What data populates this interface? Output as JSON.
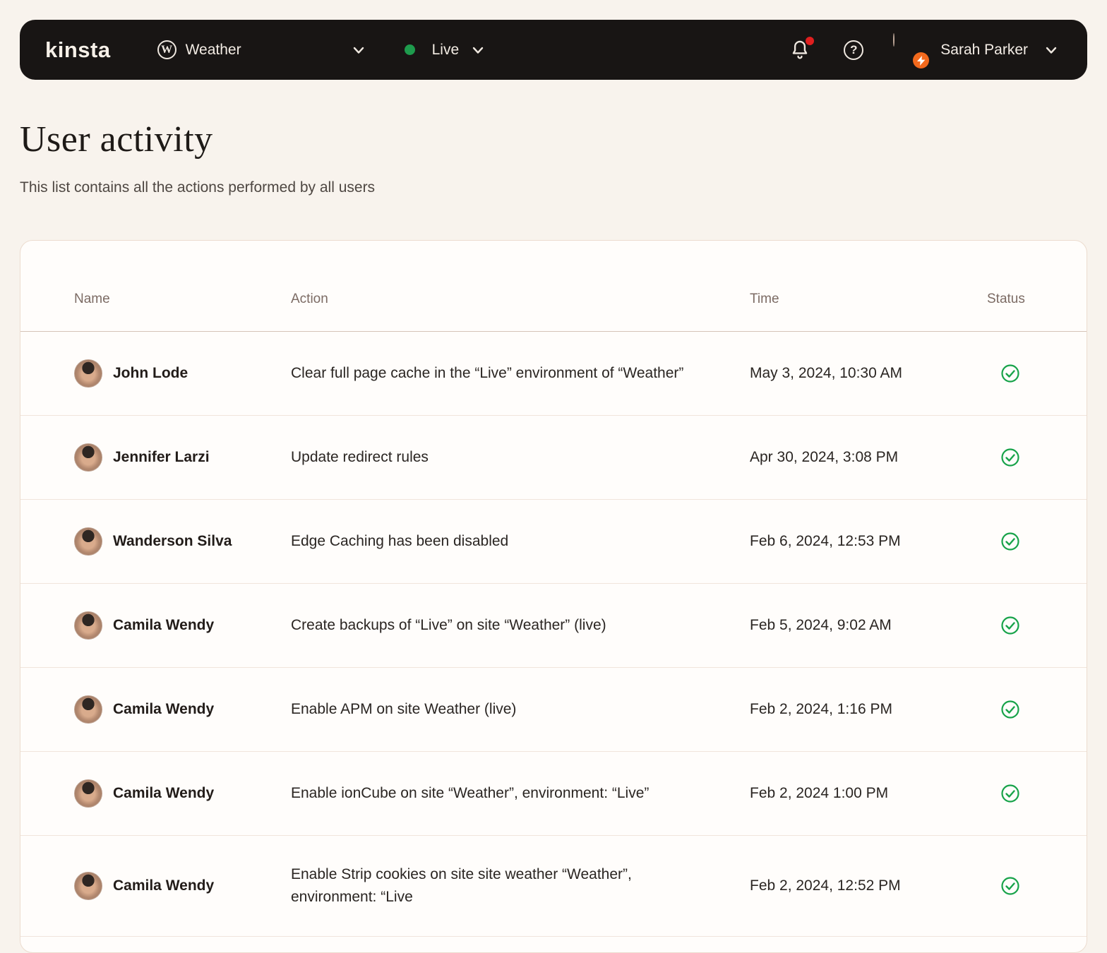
{
  "topbar": {
    "logo_text": "kinsta",
    "site_selector": {
      "icon": "wordpress-icon",
      "label": "Weather"
    },
    "env_selector": {
      "icon": "green-status-dot",
      "label": "Live"
    },
    "notifications": {
      "icon": "bell-icon",
      "has_unread": true
    },
    "help": {
      "icon": "help-icon"
    },
    "user": {
      "name": "Sarah Parker",
      "avatar": "avatar",
      "badge_icon": "lightning-icon"
    }
  },
  "page": {
    "title": "User activity",
    "subtitle": "This list contains all the actions performed by all users"
  },
  "table": {
    "headers": [
      "Name",
      "Action",
      "Time",
      "Status"
    ],
    "rows": [
      {
        "name": "John Lode",
        "action": "Clear full page cache in the “Live” environment of “Weather”",
        "time": "May 3, 2024, 10:30 AM",
        "status": "success"
      },
      {
        "name": "Jennifer Larzi",
        "action": "Update redirect rules",
        "time": "Apr 30, 2024, 3:08 PM",
        "status": "success"
      },
      {
        "name": "Wanderson Silva",
        "action": "Edge Caching has been disabled",
        "time": "Feb 6, 2024, 12:53 PM",
        "status": "success"
      },
      {
        "name": "Camila Wendy",
        "action": "Create backups of “Live” on site “Weather” (live)",
        "time": "Feb 5, 2024, 9:02 AM",
        "status": "success"
      },
      {
        "name": "Camila Wendy",
        "action": "Enable APM on site Weather (live)",
        "time": "Feb 2, 2024, 1:16 PM",
        "status": "success"
      },
      {
        "name": "Camila Wendy",
        "action": "Enable ionCube on site “Weather”, environment: “Live”",
        "time": "Feb 2, 2024 1:00 PM",
        "status": "success"
      },
      {
        "name": "Camila Wendy",
        "action": "Enable Strip cookies on site site weather “Weather”, environment: “Live",
        "time": "Feb 2, 2024, 12:52 PM",
        "status": "success"
      }
    ]
  },
  "colors": {
    "page_background": "#f8f3ed",
    "topbar_background": "#181514",
    "status_success_green": "#18a34a",
    "live_dot_green": "#1e9b4d",
    "notification_red": "#e01f1f",
    "badge_orange": "#f2691d",
    "card_border": "#ecdccf"
  }
}
